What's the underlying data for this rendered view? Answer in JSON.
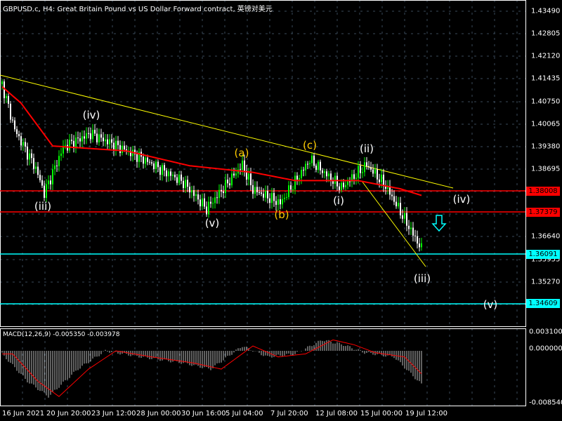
{
  "header": {
    "title": "GBPUSD.c, H4:  Great Britain Pound vs US Dollar Forward contract, 英镑对美元"
  },
  "price_axis": {
    "ticks": [
      "1.43490",
      "1.42805",
      "1.42120",
      "1.41435",
      "1.40750",
      "1.40065",
      "1.39380",
      "1.38695",
      "1.35955",
      "1.36640",
      "1.35270"
    ],
    "levels": [
      {
        "label": "1.38008",
        "color": "#ff0000"
      },
      {
        "label": "1.37379",
        "color": "#ff0000"
      },
      {
        "label": "1.36091",
        "color": "#00ffff"
      },
      {
        "label": "1.34609",
        "color": "#00ffff"
      }
    ]
  },
  "macd": {
    "title": "MACD(12,26,9) -0.005350 -0.003978",
    "ticks": [
      "0.003100",
      "0.000000",
      "-0.008540"
    ]
  },
  "time_axis": [
    "16 Jun 2021",
    "20 Jun 20:00",
    "23 Jun 12:00",
    "28 Jun 00:00",
    "30 Jun 16:00",
    "5 Jul 04:00",
    "7 Jul 20:00",
    "12 Jul 08:00",
    "15 Jul 00:00",
    "19 Jul 12:00"
  ],
  "waves": {
    "iii1": "(iii)",
    "iv1": "(iv)",
    "v1": "(v)",
    "a": "(a)",
    "b": "(b)",
    "c": "(c)",
    "i": "(i)",
    "ii": "(ii)",
    "iv2": "(iv)",
    "iii2": "(iii)",
    "v2": "(v)"
  },
  "colors": {
    "bull": "#00ff00",
    "bear": "#ffffff",
    "ma": "#ff0000",
    "trend": "#ffff00",
    "wave_white": "#ffffff",
    "wave_yellow": "#ffcc00"
  },
  "chart_data": {
    "type": "candlestick",
    "price_waypoints": [
      [
        1,
        1.4128
      ],
      [
        7,
        1.3989
      ],
      [
        17,
        1.3872
      ],
      [
        21,
        1.3797
      ],
      [
        30,
        1.3936
      ],
      [
        43,
        1.3978
      ],
      [
        67,
        1.3904
      ],
      [
        87,
        1.383
      ],
      [
        98,
        1.3749
      ],
      [
        115,
        1.3883
      ],
      [
        120,
        1.3808
      ],
      [
        133,
        1.3766
      ],
      [
        147,
        1.3898
      ],
      [
        162,
        1.3813
      ],
      [
        174,
        1.3883
      ],
      [
        183,
        1.3819
      ],
      [
        200,
        1.3627
      ]
    ],
    "ma_waypoints": [
      [
        1,
        1.412
      ],
      [
        10,
        1.407
      ],
      [
        25,
        1.394
      ],
      [
        60,
        1.3925
      ],
      [
        90,
        1.388
      ],
      [
        120,
        1.386
      ],
      [
        140,
        1.3835
      ],
      [
        170,
        1.3835
      ],
      [
        190,
        1.381
      ],
      [
        200,
        1.379
      ]
    ],
    "macd_waypoints": [
      [
        1,
        -0.0005
      ],
      [
        13,
        -0.005
      ],
      [
        23,
        -0.0075
      ],
      [
        37,
        -0.003
      ],
      [
        50,
        0
      ],
      [
        67,
        -0.001
      ],
      [
        87,
        -0.002
      ],
      [
        100,
        -0.003
      ],
      [
        115,
        0.0008
      ],
      [
        127,
        -0.001
      ],
      [
        140,
        -0.0005
      ],
      [
        153,
        0.0018
      ],
      [
        163,
        0.001
      ],
      [
        173,
        -0.0003
      ],
      [
        187,
        -0.001
      ],
      [
        200,
        -0.0055
      ]
    ]
  }
}
